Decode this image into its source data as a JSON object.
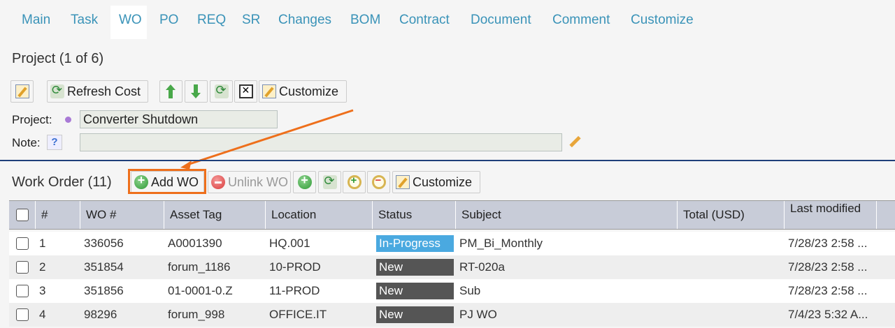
{
  "tabs": [
    {
      "label": "Main"
    },
    {
      "label": "Task"
    },
    {
      "label": "WO"
    },
    {
      "label": "PO"
    },
    {
      "label": "REQ"
    },
    {
      "label": "SR"
    },
    {
      "label": "Changes"
    },
    {
      "label": "BOM"
    },
    {
      "label": "Contract"
    },
    {
      "label": "Document"
    },
    {
      "label": "Comment"
    },
    {
      "label": "Customize"
    }
  ],
  "project": {
    "title": "Project (1 of 6)",
    "refresh_label": "Refresh Cost",
    "customize_label": "Customize",
    "project_label": "Project:",
    "project_value": "Converter Shutdown",
    "note_label": "Note:",
    "note_value": "",
    "help_glyph": "?"
  },
  "workorder": {
    "title": "Work Order (11)",
    "add_label": "Add WO",
    "unlink_label": "Unlink WO",
    "customize_label": "Customize",
    "columns": [
      "#",
      "WO #",
      "Asset Tag",
      "Location",
      "Status",
      "Subject",
      "Total (USD)",
      "Last modified"
    ],
    "rows": [
      {
        "num": "1",
        "wo": "336056",
        "asset": "A0001390",
        "location": "HQ.001",
        "status": "In-Progress",
        "subject": "PM_Bi_Monthly",
        "total": "",
        "modified": "7/28/23 2:58 ..."
      },
      {
        "num": "2",
        "wo": "351854",
        "asset": "forum_1186",
        "location": "10-PROD",
        "status": "New",
        "subject": "RT-020a",
        "total": "",
        "modified": "7/28/23 2:58 ..."
      },
      {
        "num": "3",
        "wo": "351856",
        "asset": "01-0001-0.Z",
        "location": "11-PROD",
        "status": "New",
        "subject": "Sub",
        "total": "",
        "modified": "7/28/23 2:58 ..."
      },
      {
        "num": "4",
        "wo": "98296",
        "asset": "forum_998",
        "location": "OFFICE.IT",
        "status": "New",
        "subject": "PJ WO",
        "total": "",
        "modified": "7/4/23 5:32 A..."
      }
    ]
  },
  "colors": {
    "tab_text": "#3a93b8",
    "status_in_progress": "#4aa9e0",
    "status_new": "#555555",
    "highlight": "#ee6f1b",
    "divider": "#1f3f7a"
  }
}
